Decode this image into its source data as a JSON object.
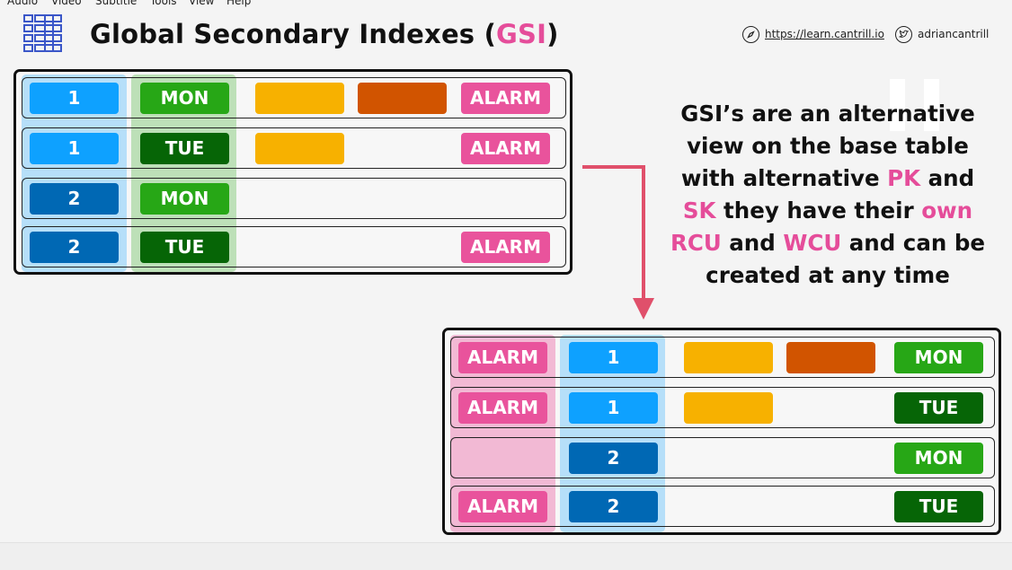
{
  "menu": [
    "Audio",
    "Video",
    "Subtitle",
    "Tools",
    "View",
    "Help"
  ],
  "header": {
    "title_prefix": "Global Secondary Indexes (",
    "title_highlight": "GSI",
    "title_suffix": ")",
    "site": "https://learn.cantrill.io",
    "handle": "adriancantrill",
    "icons": [
      "table-grid-icon",
      "compass-icon",
      "twitter-icon"
    ]
  },
  "base_table": {
    "rows": [
      {
        "pk": "1",
        "sk": "MON",
        "alarm": "ALARM"
      },
      {
        "pk": "1",
        "sk": "TUE",
        "alarm": "ALARM"
      },
      {
        "pk": "2",
        "sk": "MON",
        "alarm": ""
      },
      {
        "pk": "2",
        "sk": "TUE",
        "alarm": "ALARM"
      }
    ]
  },
  "gsi_table": {
    "rows": [
      {
        "alarm": "ALARM",
        "pk": "1",
        "sk": "MON"
      },
      {
        "alarm": "ALARM",
        "pk": "1",
        "sk": "TUE"
      },
      {
        "alarm": "",
        "pk": "2",
        "sk": "MON"
      },
      {
        "alarm": "ALARM",
        "pk": "2",
        "sk": "TUE"
      }
    ]
  },
  "description": {
    "t1": "GSI’s are an alternative view on the base table with alternative ",
    "pk": "PK",
    "t2": " and ",
    "sk": "SK",
    "t3": " they have their ",
    "own": "own",
    "t4": " ",
    "rcu": "RCU",
    "t5": " and ",
    "wcu": "WCU",
    "t6": " and can be created at any time"
  },
  "colors": {
    "pink": "#e9539c",
    "light_blue": "#0ea1ff",
    "dark_blue": "#0068b4",
    "light_green": "#27a716",
    "dark_green": "#066506",
    "yellow": "#f7b100",
    "orange": "#d15400",
    "arrow": "#e0506b"
  }
}
